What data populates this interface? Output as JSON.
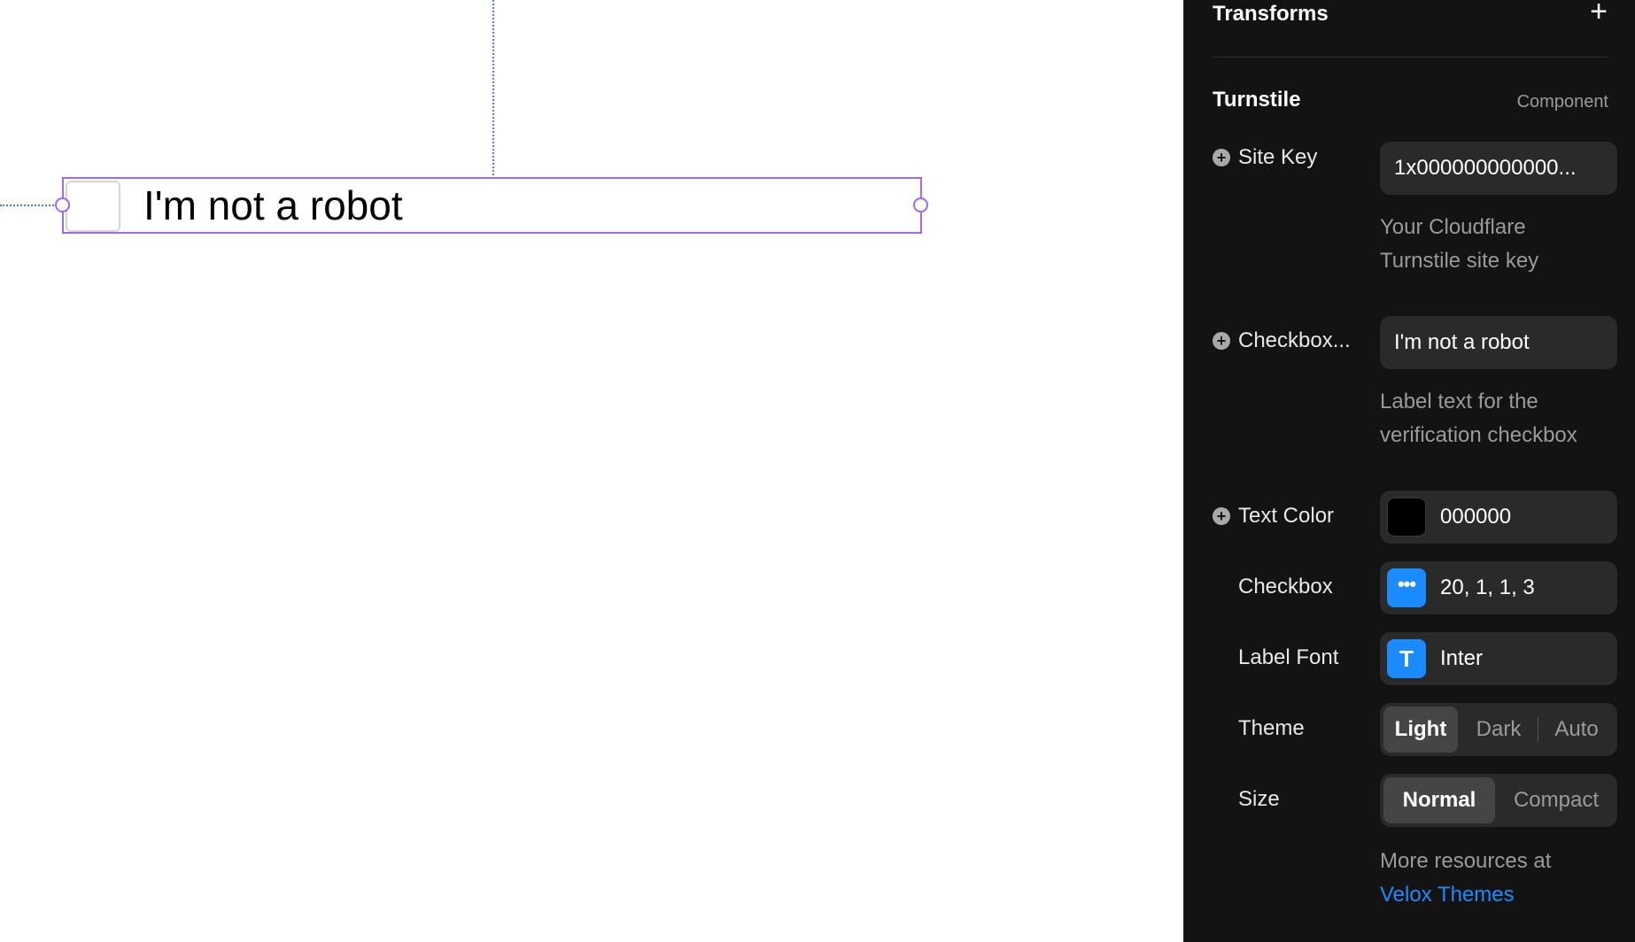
{
  "canvas": {
    "checkbox_label": "I'm not a robot"
  },
  "panel": {
    "transforms_title": "Transforms",
    "add_icon": "plus-icon",
    "section_title": "Turnstile",
    "section_type": "Component",
    "site_key": {
      "label": "Site Key",
      "value": "1x000000000000...",
      "hint_line1": "Your Cloudflare",
      "hint_line2": "Turnstile site key"
    },
    "checkbox_label_prop": {
      "label": "Checkbox...",
      "value": "I'm not a robot",
      "hint_line1": "Label text for the",
      "hint_line2": "verification checkbox"
    },
    "text_color": {
      "label": "Text Color",
      "value": "000000",
      "swatch": "#000000"
    },
    "checkbox": {
      "label": "Checkbox",
      "value": "20, 1, 1, 3",
      "icon": "ellipsis-icon",
      "icon_color": "#1a8cff"
    },
    "label_font": {
      "label": "Label Font",
      "value": "Inter",
      "icon": "text-t-icon",
      "icon_glyph": "T",
      "icon_color": "#1a8cff"
    },
    "theme": {
      "label": "Theme",
      "options": [
        "Light",
        "Dark",
        "Auto"
      ],
      "selected": "Light"
    },
    "size": {
      "label": "Size",
      "options": [
        "Normal",
        "Compact"
      ],
      "selected": "Normal"
    },
    "more_text": "More resources at",
    "link_text": "Velox Themes",
    "link_color": "#1a8cff"
  }
}
